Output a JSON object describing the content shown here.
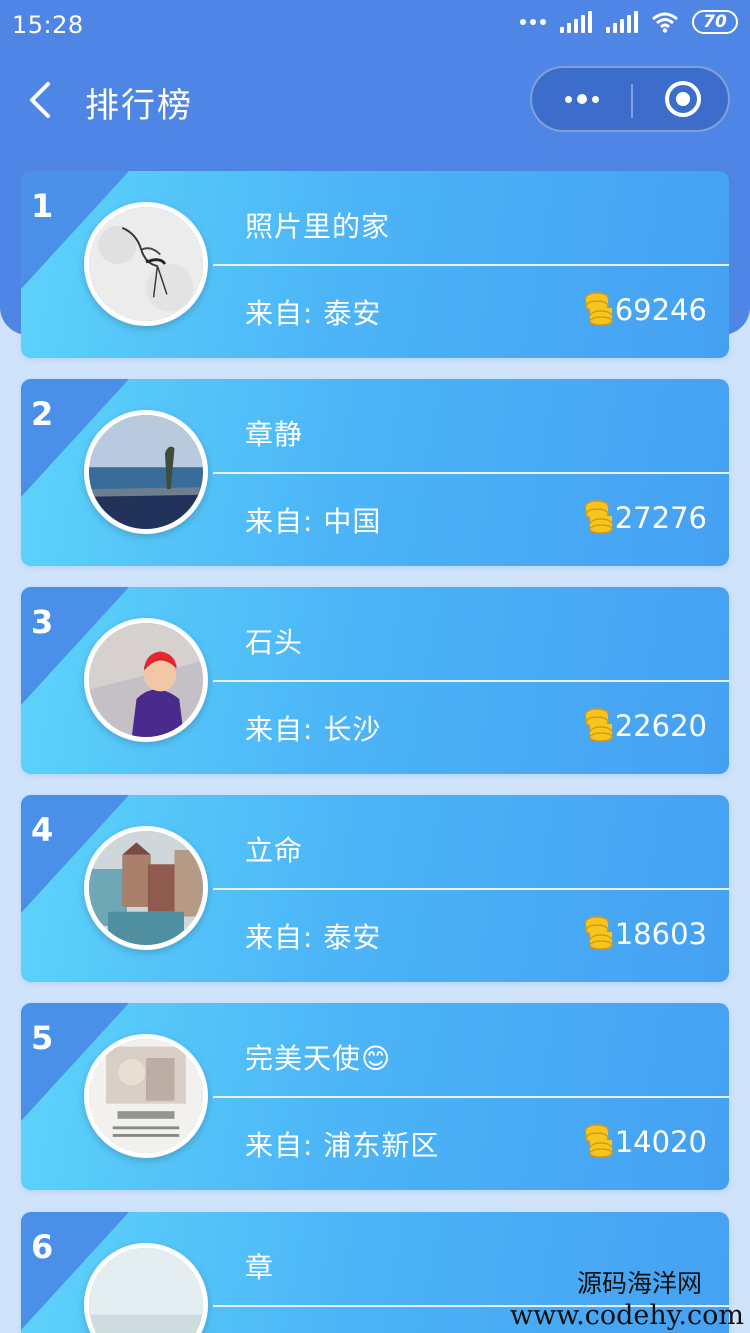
{
  "status_bar": {
    "time": "15:28",
    "battery": "70"
  },
  "nav": {
    "title": "排行榜"
  },
  "colors": {
    "header": "#4f86e6",
    "page_bg": "#cfe3fb",
    "card_start": "#5dd4fa",
    "card_end": "#45a0f2",
    "rank_corner": "#4a8fe8",
    "coin": "#f7c520"
  },
  "ranking": [
    {
      "rank": "1",
      "name": "照片里的家",
      "from": "来自: 泰安",
      "score": "69246",
      "avatar_icon": "crane-sketch-avatar"
    },
    {
      "rank": "2",
      "name": "章静",
      "from": "来自: 中国",
      "score": "27276",
      "avatar_icon": "seaside-avatar"
    },
    {
      "rank": "3",
      "name": "石头",
      "from": "来自: 长沙",
      "score": "22620",
      "avatar_icon": "child-photo-avatar"
    },
    {
      "rank": "4",
      "name": "立命",
      "from": "来自: 泰安",
      "score": "18603",
      "avatar_icon": "painting-avatar"
    },
    {
      "rank": "5",
      "name": "完美天使😊",
      "from": "来自: 浦东新区",
      "score": "14020",
      "avatar_icon": "book-cover-avatar"
    },
    {
      "rank": "6",
      "name": "章",
      "from": "",
      "score": "",
      "avatar_icon": "pale-landscape-avatar"
    }
  ],
  "watermark": {
    "line1": "源码海洋网",
    "line2": "www.codehy.com"
  }
}
